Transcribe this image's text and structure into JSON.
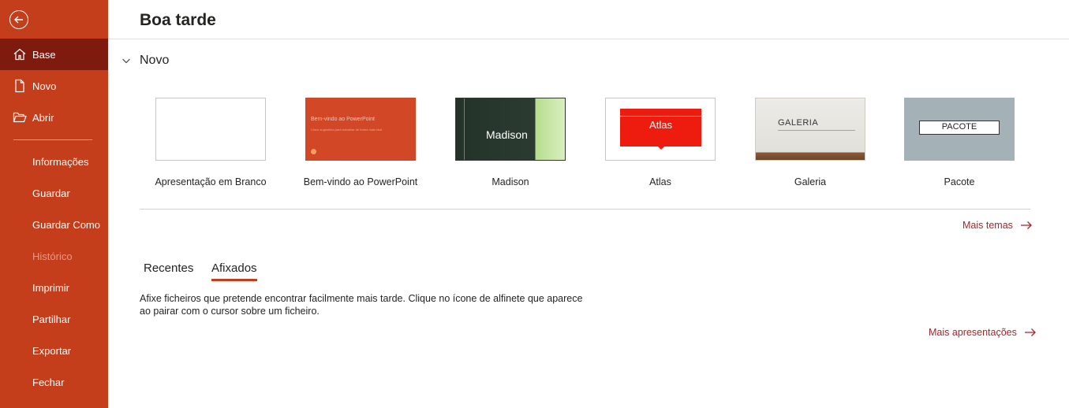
{
  "sidebar": {
    "back_icon": "back-arrow-icon",
    "main_items": [
      {
        "label": "Base",
        "icon": "home-icon",
        "active": true
      },
      {
        "label": "Novo",
        "icon": "new-document-icon",
        "active": false
      },
      {
        "label": "Abrir",
        "icon": "folder-open-icon",
        "active": false
      }
    ],
    "sub_items": [
      {
        "label": "Informações",
        "enabled": true
      },
      {
        "label": "Guardar",
        "enabled": true
      },
      {
        "label": "Guardar Como",
        "enabled": true
      },
      {
        "label": "Histórico",
        "enabled": false
      },
      {
        "label": "Imprimir",
        "enabled": true
      },
      {
        "label": "Partilhar",
        "enabled": true
      },
      {
        "label": "Exportar",
        "enabled": true
      },
      {
        "label": "Fechar",
        "enabled": true
      }
    ]
  },
  "main": {
    "greeting": "Boa tarde",
    "new_section": {
      "label": "Novo",
      "expanded": true
    },
    "templates": [
      {
        "caption": "Apresentação em Branco"
      },
      {
        "caption": "Bem-vindo ao PowerPoint",
        "thumb_title": "Bem-vindo ao PowerPoint",
        "thumb_sub": "Cinco sugestões para trabalhar de forma mais fácil"
      },
      {
        "caption": "Madison",
        "thumb_title": "Madison"
      },
      {
        "caption": "Atlas",
        "thumb_title": "Atlas"
      },
      {
        "caption": "Galeria",
        "thumb_title": "GALERIA"
      },
      {
        "caption": "Pacote",
        "thumb_title": "PACOTE"
      }
    ],
    "more_themes": "Mais temas",
    "tabs": [
      {
        "label": "Recentes",
        "active": false
      },
      {
        "label": "Afixados",
        "active": true
      }
    ],
    "pinned_hint": "Afixe ficheiros que pretende encontrar facilmente mais tarde. Clique no ícone de alfinete que aparece ao pairar com o cursor sobre um ficheiro.",
    "more_presentations": "Mais apresentações"
  },
  "colors": {
    "accent": "#c43e1c",
    "active_nav": "#7f1a0f",
    "link": "#a4262c"
  }
}
